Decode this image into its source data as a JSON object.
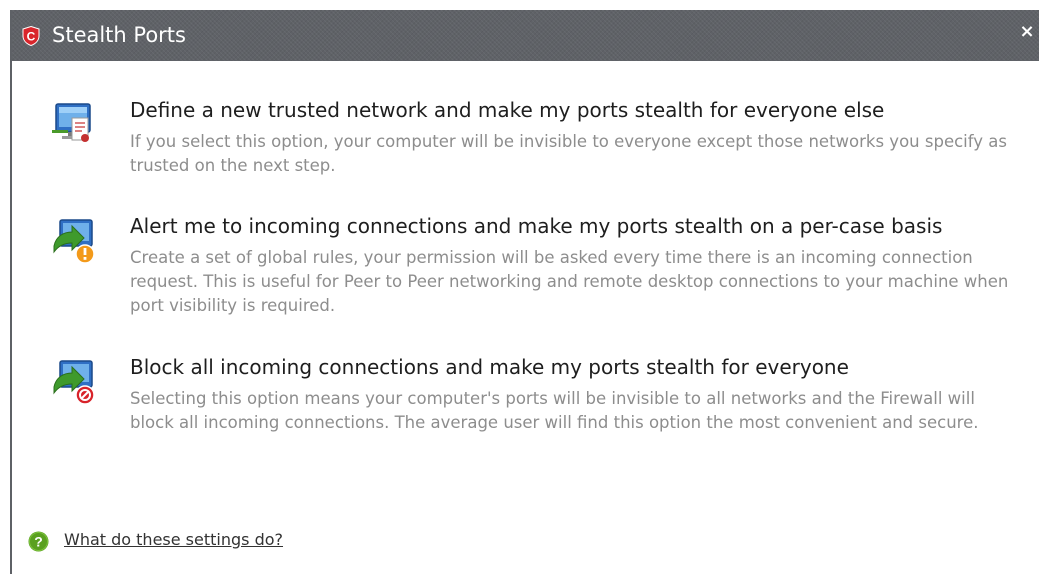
{
  "window": {
    "title": "Stealth Ports",
    "close_glyph": "×",
    "logo_icon": "comodo-shield-icon"
  },
  "options": [
    {
      "icon": "trusted-network-icon",
      "title": "Define a new trusted network and make my ports stealth for everyone else",
      "description": "If you select this option, your computer will be invisible to everyone except those networks you specify as trusted on the next step."
    },
    {
      "icon": "alert-network-icon",
      "title": "Alert me to incoming connections and make my ports stealth on a per-case basis",
      "description": "Create a set of global rules, your permission will be asked every time there is an incoming connection request. This is useful for Peer to Peer networking and remote desktop connections to your machine when port visibility is required."
    },
    {
      "icon": "block-network-icon",
      "title": "Block all incoming connections and make my ports stealth for everyone",
      "description": "Selecting this option means your computer's ports will be invisible to all networks and the Firewall will block all incoming connections. The average user will find this option the most convenient and secure."
    }
  ],
  "help": {
    "icon": "help-question-icon",
    "link_text": "What do these settings do?"
  },
  "colors": {
    "titlebar": "#5f6267",
    "title_text": "#ffffff",
    "option_title": "#1e1e1e",
    "option_desc": "#8d8d8d",
    "logo_red": "#d9262c",
    "help_green": "#5aa020"
  }
}
